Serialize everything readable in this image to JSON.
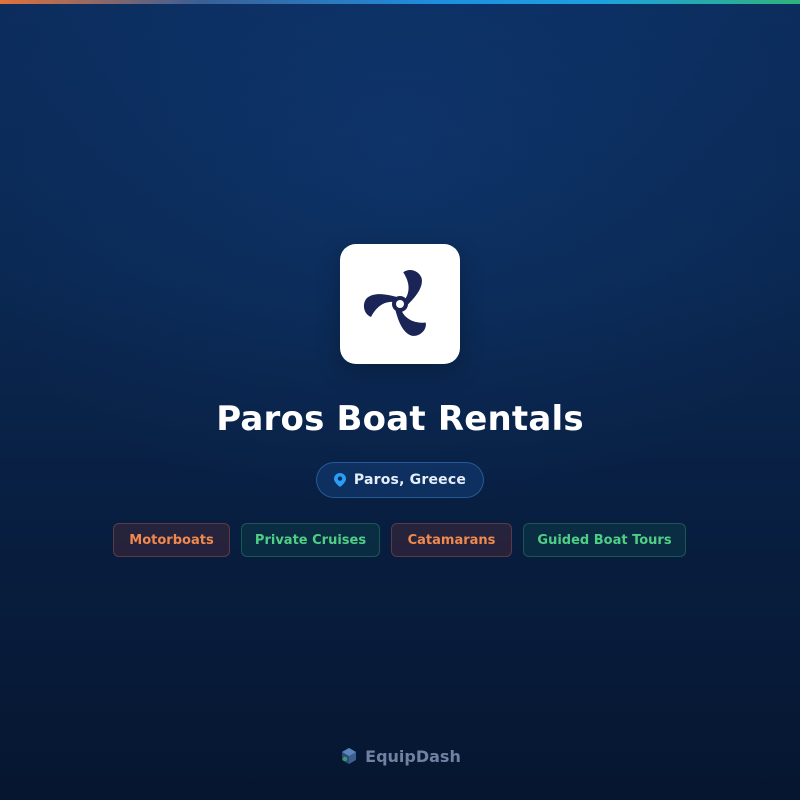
{
  "business": {
    "name": "Paros Boat Rentals",
    "logo_icon": "propeller-icon",
    "location": "Paros, Greece",
    "location_icon": "map-pin-icon"
  },
  "tags": [
    {
      "label": "Motorboats",
      "color": "orange"
    },
    {
      "label": "Private Cruises",
      "color": "green"
    },
    {
      "label": "Catamarans",
      "color": "orange"
    },
    {
      "label": "Guided Boat Tours",
      "color": "green"
    }
  ],
  "footer": {
    "brand": "EquipDash",
    "brand_icon": "equipdash-logo-icon"
  },
  "colors": {
    "background": "#0a2750",
    "accent_blue": "#1e8fe0",
    "tag_orange": "#f0894e",
    "tag_green": "#4fcf86",
    "logo_navy": "#1b2456"
  }
}
